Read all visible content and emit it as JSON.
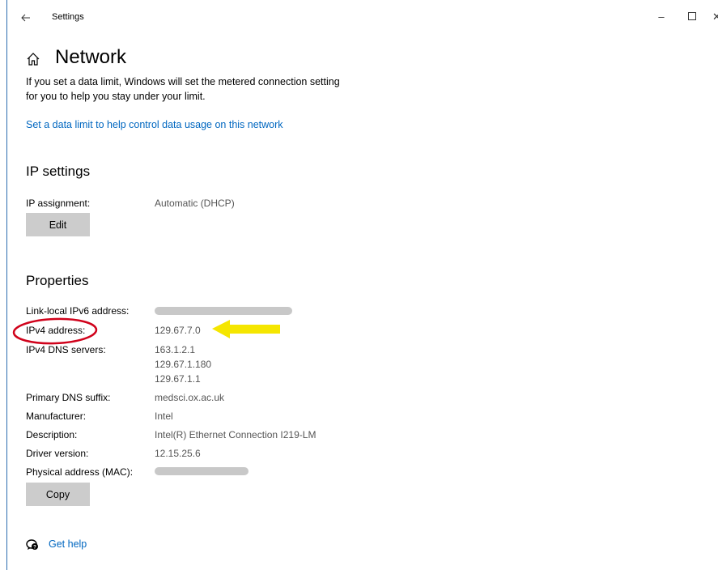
{
  "window": {
    "title": "Settings",
    "back_icon": "arrow-left-icon",
    "minimize_glyph": "–",
    "maximize_glyph": "☐",
    "close_glyph": "✕"
  },
  "page": {
    "home_icon": "home-icon",
    "title": "Network",
    "intro": "If you set a data limit, Windows will set the metered connection setting for you to help you stay under your limit.",
    "data_limit_link": "Set a data limit to help control data usage on this network"
  },
  "ip_settings": {
    "heading": "IP settings",
    "assignment_label": "IP assignment:",
    "assignment_value": "Automatic (DHCP)",
    "edit_button": "Edit"
  },
  "properties": {
    "heading": "Properties",
    "rows": [
      {
        "label": "Link-local IPv6 address:",
        "redacted": true
      },
      {
        "label": "IPv4 address:",
        "value": "129.67.7.0"
      },
      {
        "label": "IPv4 DNS servers:",
        "values": [
          "163.1.2.1",
          "129.67.1.180",
          "129.67.1.1"
        ]
      },
      {
        "label": "Primary DNS suffix:",
        "value": "medsci.ox.ac.uk"
      },
      {
        "label": "Manufacturer:",
        "value": "Intel"
      },
      {
        "label": "Description:",
        "value": "Intel(R) Ethernet Connection I219-LM"
      },
      {
        "label": "Driver version:",
        "value": "12.15.25.6"
      },
      {
        "label": "Physical address (MAC):",
        "redacted": true
      }
    ],
    "copy_button": "Copy"
  },
  "annotations": {
    "circle_color": "#d0021b",
    "arrow_color": "#f5e600"
  },
  "help": {
    "icon": "help-chat-icon",
    "link": "Get help"
  },
  "colors": {
    "accent": "#0067c0",
    "button_bg": "#cccccc",
    "value_text": "#555555"
  }
}
